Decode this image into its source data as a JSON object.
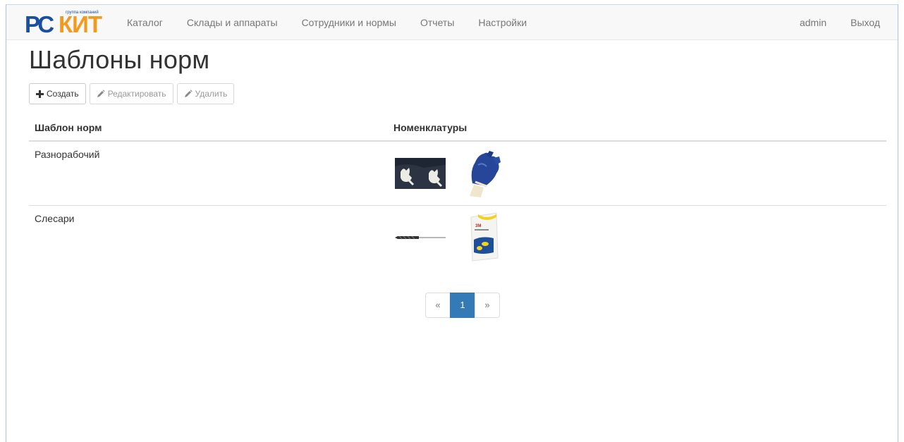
{
  "navbar": {
    "brand_caption": "группа компаний",
    "brand_text": "РСКИТ",
    "items": [
      {
        "label": "Каталог"
      },
      {
        "label": "Склады и аппараты"
      },
      {
        "label": "Сотрудники и нормы"
      },
      {
        "label": "Отчеты"
      },
      {
        "label": "Настройки"
      }
    ],
    "user": "admin",
    "logout": "Выход"
  },
  "page": {
    "title": "Шаблоны норм"
  },
  "toolbar": {
    "create": "Создать",
    "edit": "Редактировать",
    "delete": "Удалить"
  },
  "table": {
    "headers": [
      "Шаблон норм",
      "Номенклатуры"
    ],
    "rows": [
      {
        "name": "Разнорабочий",
        "items": [
          "white-gloves-image",
          "blue-coated-gloves-image"
        ]
      },
      {
        "name": "Слесари",
        "items": [
          "drill-bit-image",
          "earplugs-pack-image"
        ]
      }
    ]
  },
  "pagination": {
    "prev": "«",
    "current": "1",
    "next": "»"
  },
  "colors": {
    "brand_blue": "#1a4fa0",
    "brand_orange": "#f39a1e",
    "accent": "#337ab7"
  }
}
